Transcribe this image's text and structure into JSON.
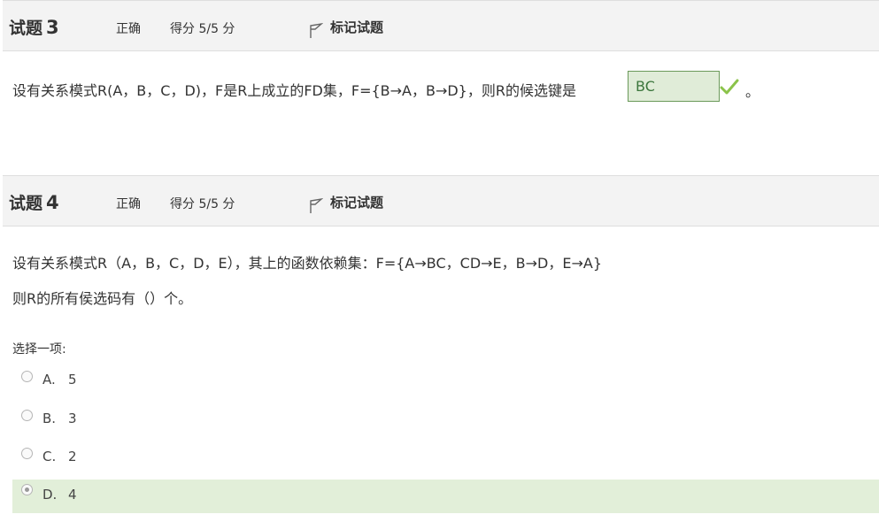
{
  "q3": {
    "title_prefix": "试题",
    "number": "3",
    "state": "正确",
    "grade": "得分 5/5 分",
    "flag_label": "标记试题",
    "text": "设有关系模式R(A，B，C，D)，F是R上成立的FD集，F={B→A，B→D}，则R的候选键是",
    "answer_value": "BC",
    "suffix": "。"
  },
  "q4": {
    "title_prefix": "试题",
    "number": "4",
    "state": "正确",
    "grade": "得分 5/5 分",
    "flag_label": "标记试题",
    "text_line1": "设有关系模式R（A，B，C，D，E），其上的函数依赖集：F={A→BC，CD→E，B→D，E→A}",
    "text_line2": "则R的所有侯选码有（）个。",
    "prompt": "选择一项:",
    "options": [
      {
        "letter": "A.",
        "value": "5"
      },
      {
        "letter": "B.",
        "value": "3"
      },
      {
        "letter": "C.",
        "value": "2"
      },
      {
        "letter": "D.",
        "value": "4"
      }
    ],
    "selected": "D."
  },
  "colors": {
    "header_bg": "#f3f3f3",
    "correct_bg": "#e2efd9",
    "check_green": "#8bc34a",
    "answer_border": "#6b9a5a"
  }
}
